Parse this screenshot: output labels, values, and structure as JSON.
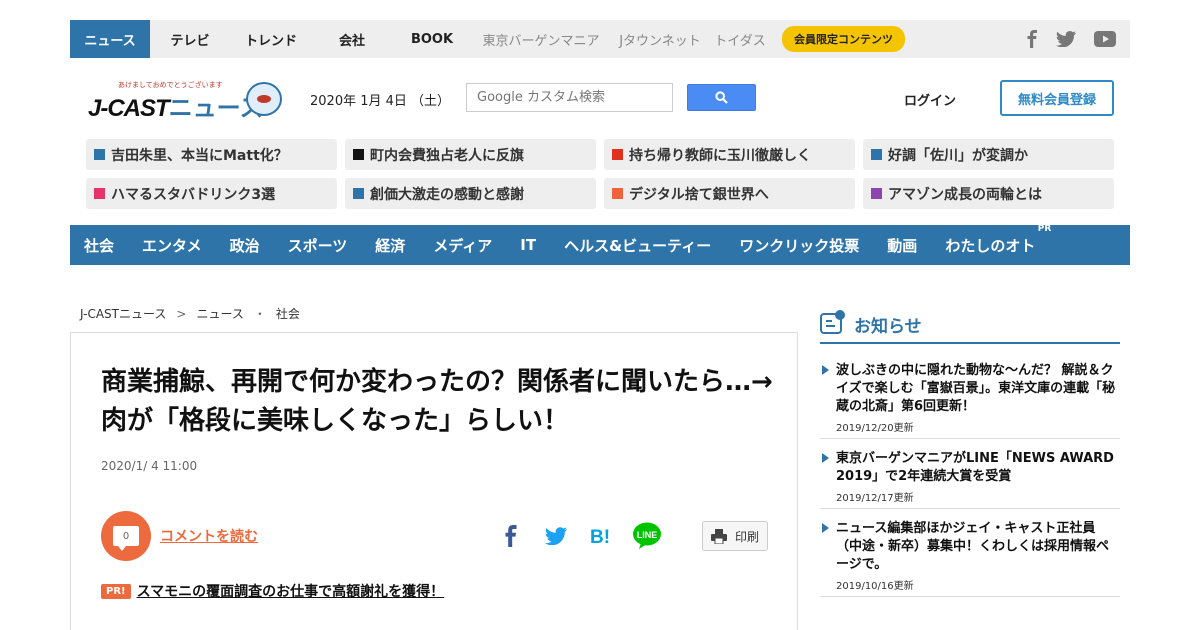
{
  "topnav": {
    "tabs": [
      {
        "label": "ニュース"
      },
      {
        "label": "テレビ"
      },
      {
        "label": "トレンド"
      },
      {
        "label": "会社"
      },
      {
        "label": "BOOK"
      },
      {
        "label": "東京バーゲンマニア"
      },
      {
        "label": "Jタウンネット"
      },
      {
        "label": "トイダス"
      }
    ],
    "member_label": "会員限定コンテンツ",
    "social_icons": [
      "facebook-icon",
      "twitter-icon",
      "youtube-icon"
    ]
  },
  "header": {
    "logo_tagline": "あけましておめでとうございます",
    "logo_text": "J-CAST",
    "logo_news": "ニュース",
    "date": "2020年 1月 4日 （土）",
    "search_placeholder": "Google カスタム検索",
    "login_label": "ログイン",
    "signup_label": "無料会員登録"
  },
  "trending": [
    {
      "label": "吉田朱里、本当にMatt化？",
      "color": "#2e74a8"
    },
    {
      "label": "町内会費独占老人に反旗",
      "color": "#111111"
    },
    {
      "label": "持ち帰り教師に玉川徹厳しく",
      "color": "#e0301e"
    },
    {
      "label": "好調「佐川」が変調か",
      "color": "#2e74a8"
    },
    {
      "label": "ハマるスタバドリンク3選",
      "color": "#e6336b"
    },
    {
      "label": "創価大激走の感動と感謝",
      "color": "#2e74a8"
    },
    {
      "label": "デジタル捨て銀世界へ",
      "color": "#f0643c"
    },
    {
      "label": "アマゾン成長の両輪とは",
      "color": "#8e44ad"
    }
  ],
  "categories": [
    {
      "label": "社会"
    },
    {
      "label": "エンタメ"
    },
    {
      "label": "政治"
    },
    {
      "label": "スポーツ"
    },
    {
      "label": "経済"
    },
    {
      "label": "メディア"
    },
    {
      "label": "IT"
    },
    {
      "label": "ヘルス&ビューティー"
    },
    {
      "label": "ワンクリック投票"
    },
    {
      "label": "動画"
    },
    {
      "label": "わたしのオト",
      "badge": "PR"
    }
  ],
  "breadcrumb": {
    "items": [
      "J-CASTニュース",
      "ニュース",
      "社会"
    ],
    "sep1": ">",
    "sep2": "・"
  },
  "article": {
    "headline": "商業捕鯨、再開で何か変わったの？関係者に聞いたら…→肉が「格段に美味しくなった」らしい！",
    "date": "2020/1/ 4 11:00",
    "comment_count": "0",
    "comment_link": "コメントを読む",
    "share_icons": [
      "facebook-share-icon",
      "twitter-share-icon",
      "hatena-bookmark-icon",
      "line-share-icon"
    ],
    "print_label": "印刷",
    "pr_badge": "PR!",
    "pr_link": "スマモニの覆面調査のお仕事で高額謝礼を獲得！"
  },
  "sidebar": {
    "title": "お知らせ",
    "notices": [
      {
        "text": "波しぶきの中に隠れた動物な～んだ？ 解説＆クイズで楽しむ「富嶽百景」。東洋文庫の連載「秘蔵の北斎」第6回更新！",
        "date": "2019/12/20更新"
      },
      {
        "text": "東京バーゲンマニアがLINE「NEWS AWARD 2019」で2年連続大賞を受賞",
        "date": "2019/12/17更新"
      },
      {
        "text": "ニュース編集部ほかジェイ・キャスト正社員（中途・新卒）募集中！くわしくは採用情報ページで。",
        "date": "2019/10/16更新"
      }
    ]
  },
  "colors": {
    "brand_blue": "#2e74a8",
    "accent_orange": "#ec6a3d",
    "member_yellow": "#f4c400"
  }
}
